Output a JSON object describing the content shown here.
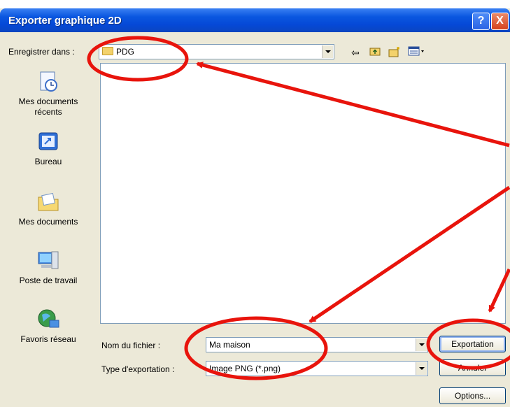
{
  "window": {
    "title": "Exporter graphique 2D",
    "help_label": "?",
    "close_label": "X"
  },
  "save_in": {
    "label": "Enregistrer dans :",
    "value": "PDG"
  },
  "toolbar": {
    "back_icon": "back-arrow-icon",
    "up_icon": "up-folder-icon",
    "new_folder_icon": "new-folder-icon",
    "view_menu_icon": "view-menu-icon"
  },
  "places": [
    {
      "label": "Mes documents récents",
      "icon": "recent-documents-icon"
    },
    {
      "label": "Bureau",
      "icon": "desktop-icon"
    },
    {
      "label": "Mes documents",
      "icon": "my-documents-icon"
    },
    {
      "label": "Poste de travail",
      "icon": "my-computer-icon"
    },
    {
      "label": "Favoris réseau",
      "icon": "network-places-icon"
    }
  ],
  "filename": {
    "label": "Nom du fichier :",
    "value": "Ma maison"
  },
  "export_type": {
    "label": "Type d'exportation :",
    "value": "Image PNG (*.png)"
  },
  "buttons": {
    "export": "Exportation",
    "cancel": "Annuler",
    "options": "Options..."
  },
  "colors": {
    "annotation": "#e8140c",
    "titlebar": "#0a57e0"
  }
}
